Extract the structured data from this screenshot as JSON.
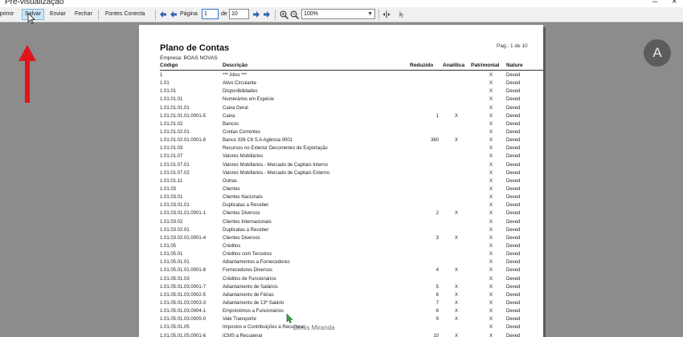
{
  "window": {
    "title": "Pré-visualização",
    "minimize": "–",
    "close": "×"
  },
  "toolbar": {
    "print": "Imprimir",
    "save": "Salvar",
    "send": "Enviar",
    "close": "Fechar",
    "fonts": "Fontes Conecta",
    "page_label": "Página",
    "page_value": "1",
    "of_label": "de",
    "total_pages": "10",
    "zoom": "100%"
  },
  "report": {
    "title": "Plano de Contas",
    "company": "Empresa:  BOAS NOVAS",
    "page_info": "Pag.: 1 de 10",
    "columns": {
      "codigo": "Código",
      "descricao": "Descrição",
      "reduzido": "Reduzido",
      "analitica": "Analítica",
      "patrimonial": "Patrimonial",
      "natureza": "Nature"
    },
    "rows": [
      {
        "cod": "1",
        "desc": "*** Ativo ***",
        "red": "",
        "ana": "",
        "pat": "X",
        "nat": "Deved"
      },
      {
        "cod": "1.01",
        "desc": "Ativo Circulante",
        "red": "",
        "ana": "",
        "pat": "X",
        "nat": "Deved"
      },
      {
        "cod": "1.01.01",
        "desc": "Disponibilidades",
        "red": "",
        "ana": "",
        "pat": "X",
        "nat": "Deved"
      },
      {
        "cod": "1.01.01.01",
        "desc": "Numerários em Espécie",
        "red": "",
        "ana": "",
        "pat": "X",
        "nat": "Deved"
      },
      {
        "cod": "1.01.01.01.01",
        "desc": "Caixa Geral",
        "red": "",
        "ana": "",
        "pat": "X",
        "nat": "Deved"
      },
      {
        "cod": "1.01.01.01.01.0001-5",
        "desc": "Caixa",
        "red": "1",
        "ana": "X",
        "pat": "X",
        "nat": "Deved"
      },
      {
        "cod": "1.01.01.02",
        "desc": "Bancos",
        "red": "",
        "ana": "",
        "pat": "X",
        "nat": "Deved"
      },
      {
        "cod": "1.01.01.02.01",
        "desc": "Contas Correntes",
        "red": "",
        "ana": "",
        "pat": "X",
        "nat": "Deved"
      },
      {
        "cod": "1.01.01.02.01.0001-8",
        "desc": "Banco 336 C6 S.A Agência 0001",
        "red": "360",
        "ana": "X",
        "pat": "X",
        "nat": "Deved"
      },
      {
        "cod": "1.01.01.03",
        "desc": "Recursos no Exterior Decorrentes de Exportação",
        "red": "",
        "ana": "",
        "pat": "X",
        "nat": "Deved"
      },
      {
        "cod": "1.01.01.07",
        "desc": "Valores Mobiliários",
        "red": "",
        "ana": "",
        "pat": "X",
        "nat": "Deved"
      },
      {
        "cod": "1.01.01.07.01",
        "desc": "Valores Mobiliários - Mercado de Capitais Interno",
        "red": "",
        "ana": "",
        "pat": "X",
        "nat": "Deved"
      },
      {
        "cod": "1.01.01.07.02",
        "desc": "Valores Mobiliários - Mercado de Capitais Externo",
        "red": "",
        "ana": "",
        "pat": "X",
        "nat": "Deved"
      },
      {
        "cod": "1.01.01.11",
        "desc": "Outras",
        "red": "",
        "ana": "",
        "pat": "X",
        "nat": "Deved"
      },
      {
        "cod": "1.01.03",
        "desc": "Clientes",
        "red": "",
        "ana": "",
        "pat": "X",
        "nat": "Deved"
      },
      {
        "cod": "1.01.03.01",
        "desc": "Clientes Nacionais",
        "red": "",
        "ana": "",
        "pat": "X",
        "nat": "Deved"
      },
      {
        "cod": "1.01.03.01.01",
        "desc": "Duplicatas a Receber",
        "red": "",
        "ana": "",
        "pat": "X",
        "nat": "Deved"
      },
      {
        "cod": "1.01.03.01.01.0001-1",
        "desc": "Clientes Diversos",
        "red": "2",
        "ana": "X",
        "pat": "X",
        "nat": "Deved"
      },
      {
        "cod": "1.01.03.02",
        "desc": "Clientes Internacionais",
        "red": "",
        "ana": "",
        "pat": "X",
        "nat": "Deved"
      },
      {
        "cod": "1.01.03.02.01",
        "desc": "Duplicatas a Receber",
        "red": "",
        "ana": "",
        "pat": "X",
        "nat": "Deved"
      },
      {
        "cod": "1.01.03.02.01.0001-4",
        "desc": "Clientes Diversos",
        "red": "3",
        "ana": "X",
        "pat": "X",
        "nat": "Deved"
      },
      {
        "cod": "1.01.05",
        "desc": "Créditos",
        "red": "",
        "ana": "",
        "pat": "X",
        "nat": "Deved"
      },
      {
        "cod": "1.01.05.01",
        "desc": "Créditos com Terceiros",
        "red": "",
        "ana": "",
        "pat": "X",
        "nat": "Deved"
      },
      {
        "cod": "1.01.05.01.01",
        "desc": "Adiantamentos a Fornecedores",
        "red": "",
        "ana": "",
        "pat": "X",
        "nat": "Deved"
      },
      {
        "cod": "1.01.05.01.01.0001-8",
        "desc": "Fornecedores Diversos",
        "red": "4",
        "ana": "X",
        "pat": "X",
        "nat": "Deved"
      },
      {
        "cod": "1.01.05.01.03",
        "desc": "Créditos de Funcionários",
        "red": "",
        "ana": "",
        "pat": "X",
        "nat": "Deved"
      },
      {
        "cod": "1.01.05.01.03.0001-7",
        "desc": "Adiantamento de Salários",
        "red": "5",
        "ana": "X",
        "pat": "X",
        "nat": "Deved"
      },
      {
        "cod": "1.01.05.01.03.0002-5",
        "desc": "Adiantamento de Férias",
        "red": "6",
        "ana": "X",
        "pat": "X",
        "nat": "Deved"
      },
      {
        "cod": "1.01.05.01.03.0003-3",
        "desc": "Adiantamento de 13º Salário",
        "red": "7",
        "ana": "X",
        "pat": "X",
        "nat": "Deved"
      },
      {
        "cod": "1.01.05.01.03.0004-1",
        "desc": "Empréstimos a Funcionários",
        "red": "8",
        "ana": "X",
        "pat": "X",
        "nat": "Deved"
      },
      {
        "cod": "1.01.05.01.03.0005-0",
        "desc": "Vale Transporte",
        "red": "9",
        "ana": "X",
        "pat": "X",
        "nat": "Deved"
      },
      {
        "cod": "1.01.05.01.05",
        "desc": "Impostos e Contribuições a Recuperar",
        "red": "",
        "ana": "",
        "pat": "X",
        "nat": "Deved"
      },
      {
        "cod": "1.01.05.01.05.0001-6",
        "desc": "ICMS a Recuperar",
        "red": "10",
        "ana": "X",
        "pat": "X",
        "nat": "Deved"
      }
    ]
  },
  "watermark": "Denis Miranda",
  "font_button": {
    "label": "A",
    "icon": "font-size-icon"
  },
  "colors": {
    "arrow": "#e0141b",
    "page_bg": "#ffffff",
    "viewport_bg": "#8c8c8c"
  }
}
